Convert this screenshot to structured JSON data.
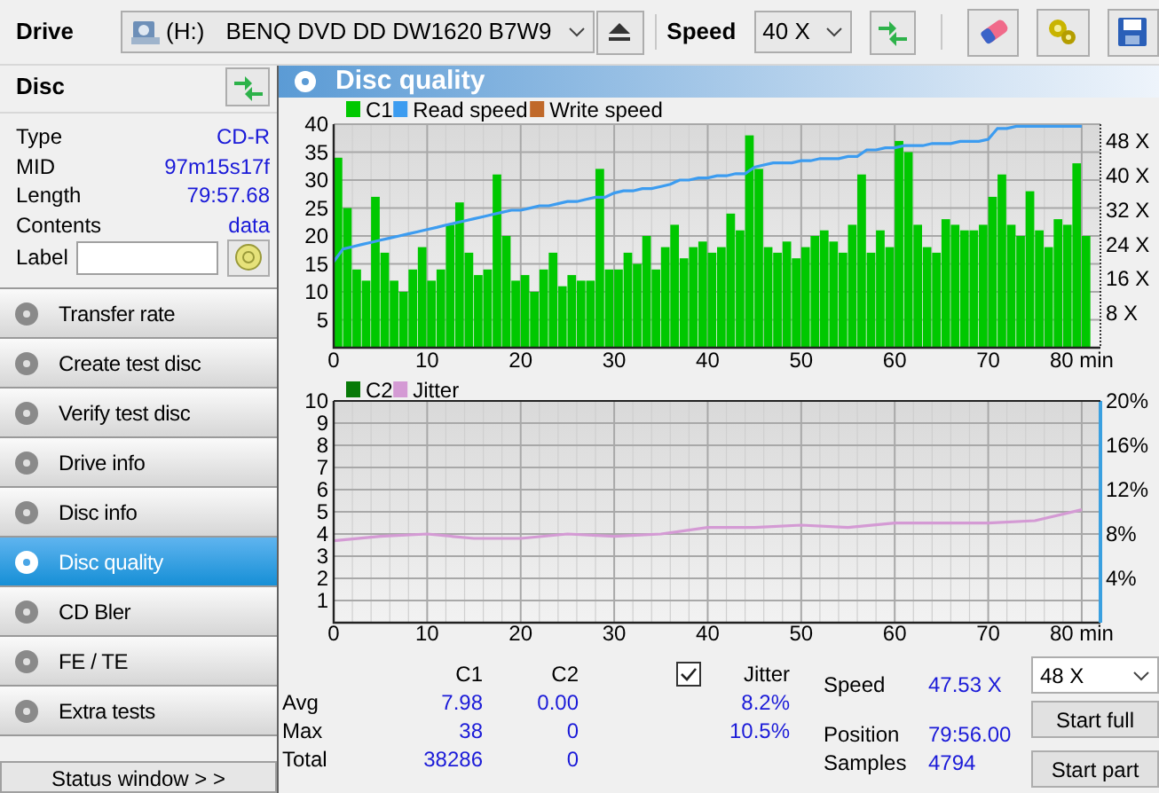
{
  "toolbar": {
    "drive_label": "Drive",
    "drive_letter": "(H:)",
    "drive_name": "BENQ DVD DD DW1620 B7W9",
    "speed_label": "Speed",
    "speed": "40 X"
  },
  "disc": {
    "title": "Disc",
    "info": [
      {
        "label": "Type",
        "value": "CD-R"
      },
      {
        "label": "MID",
        "value": "97m15s17f"
      },
      {
        "label": "Length",
        "value": "79:57.68"
      },
      {
        "label": "Contents",
        "value": "data"
      }
    ],
    "label_field": {
      "label": "Label"
    }
  },
  "nav": [
    {
      "label": "Transfer rate",
      "selected": false
    },
    {
      "label": "Create test disc",
      "selected": false
    },
    {
      "label": "Verify test disc",
      "selected": false
    },
    {
      "label": "Drive info",
      "selected": false
    },
    {
      "label": "Disc info",
      "selected": false
    },
    {
      "label": "Disc quality",
      "selected": true
    },
    {
      "label": "CD Bler",
      "selected": false
    },
    {
      "label": "FE / TE",
      "selected": false
    },
    {
      "label": "Extra tests",
      "selected": false
    }
  ],
  "status_button": "Status window > >",
  "panel": {
    "title": "Disc quality"
  },
  "charts": [
    {
      "chart_data": {
        "type": "bar",
        "grid": true,
        "legend": true,
        "x": [
          0,
          1,
          2,
          3,
          4,
          5,
          6,
          7,
          8,
          9,
          10,
          11,
          12,
          13,
          14,
          15,
          16,
          17,
          18,
          19,
          20,
          21,
          22,
          23,
          24,
          25,
          26,
          27,
          28,
          29,
          30,
          31,
          32,
          33,
          34,
          35,
          36,
          37,
          38,
          39,
          40,
          41,
          42,
          43,
          44,
          45,
          46,
          47,
          48,
          49,
          50,
          51,
          52,
          53,
          54,
          55,
          56,
          57,
          58,
          59,
          60,
          61,
          62,
          63,
          64,
          65,
          66,
          67,
          68,
          69,
          70,
          71,
          72,
          73,
          74,
          75,
          76,
          77,
          78,
          79,
          80
        ],
        "series": [
          {
            "name": "C1",
            "color": "#00c800",
            "values": [
              34,
              25,
              14,
              12,
              27,
              17,
              12,
              10,
              14,
              18,
              12,
              14,
              22,
              26,
              17,
              13,
              14,
              31,
              20,
              12,
              13,
              10,
              14,
              17,
              11,
              13,
              12,
              12,
              32,
              14,
              14,
              17,
              15,
              20,
              14,
              18,
              22,
              16,
              18,
              19,
              17,
              18,
              24,
              21,
              38,
              32,
              18,
              17,
              19,
              16,
              18,
              20,
              21,
              19,
              17,
              22,
              31,
              17,
              21,
              18,
              37,
              35,
              22,
              18,
              17,
              23,
              22,
              21,
              21,
              22,
              27,
              31,
              22,
              20,
              28,
              21,
              18,
              23,
              22,
              33,
              20
            ]
          },
          {
            "name": "Read speed",
            "color": "#3c9cf0",
            "type": "line",
            "axis": "y2",
            "values": [
              20,
              23,
              23.5,
              24,
              24.5,
              25,
              25.5,
              26,
              26.5,
              27,
              27.5,
              28,
              28.5,
              29,
              29.5,
              30,
              30.5,
              31,
              31.5,
              32,
              32,
              32.5,
              33,
              33,
              33.5,
              34,
              34,
              34.5,
              35,
              35,
              36,
              36.5,
              36.5,
              37,
              37,
              37.5,
              38,
              39,
              39,
              39.5,
              39.5,
              40,
              40,
              40.5,
              40.5,
              42,
              42.5,
              43,
              43,
              43,
              43.5,
              43.5,
              44,
              44,
              44,
              44.5,
              44.5,
              46,
              46,
              46.5,
              46.5,
              47,
              47,
              47,
              47.5,
              47.5,
              47.5,
              48,
              48,
              48,
              48.5,
              51,
              51,
              51.5,
              51.5,
              51.5,
              51.5,
              51.5,
              51.5,
              51.5,
              51.5
            ]
          },
          {
            "name": "Write speed",
            "color": "#c0692a",
            "type": "line",
            "axis": "y2",
            "values": [
              null,
              null,
              null,
              null,
              null,
              null,
              null,
              null,
              null,
              null,
              null,
              null,
              null,
              null,
              null,
              null,
              null,
              null,
              null,
              null,
              null,
              null,
              null,
              null,
              null,
              null,
              null,
              null,
              null,
              null,
              null,
              null,
              null,
              null,
              null,
              null,
              null,
              null,
              null,
              null,
              null,
              null,
              null,
              null,
              null,
              null,
              null,
              null,
              null,
              null,
              null,
              null,
              null,
              null,
              null,
              null,
              null,
              null,
              null,
              null,
              null,
              null,
              null,
              null,
              null,
              null,
              null,
              null,
              null,
              null,
              null,
              null,
              null,
              null,
              null,
              null,
              null,
              null,
              null,
              null,
              null
            ]
          }
        ],
        "xlim": [
          0,
          82
        ],
        "ylim": [
          0,
          40
        ],
        "y2lim": [
          0,
          52
        ],
        "xticks": [
          0,
          10,
          20,
          30,
          40,
          50,
          60,
          70,
          {
            "value": 80,
            "label": "80 min"
          }
        ],
        "yticks": [
          5,
          10,
          15,
          20,
          25,
          30,
          35,
          40
        ],
        "y2ticks": [
          {
            "value": 8,
            "label": "8 X"
          },
          {
            "value": 16,
            "label": "16 X"
          },
          {
            "value": 24,
            "label": "24 X"
          },
          {
            "value": 32,
            "label": "32 X"
          },
          {
            "value": 40,
            "label": "40 X"
          },
          {
            "value": 48,
            "label": "48 X"
          }
        ]
      }
    },
    {
      "chart_data": {
        "type": "bar",
        "grid": true,
        "legend": true,
        "x": [
          0,
          5,
          10,
          15,
          20,
          25,
          30,
          35,
          40,
          45,
          50,
          55,
          60,
          65,
          70,
          75,
          80
        ],
        "series": [
          {
            "name": "C2",
            "color": "#087a08",
            "values": [
              0,
              0,
              0,
              0,
              0,
              0,
              0,
              0,
              0,
              0,
              0,
              0,
              0,
              0,
              0,
              0,
              0
            ]
          },
          {
            "name": "Jitter",
            "color": "#d49ad4",
            "type": "line",
            "axis": "y2",
            "values": [
              7.4,
              7.8,
              8,
              7.6,
              7.6,
              8,
              7.8,
              8,
              8.6,
              8.6,
              8.8,
              8.6,
              9,
              9,
              9,
              9.2,
              10.2
            ]
          }
        ],
        "xlim": [
          0,
          82
        ],
        "ylim": [
          0,
          10
        ],
        "y2lim": [
          0,
          20
        ],
        "xticks": [
          0,
          10,
          20,
          30,
          40,
          50,
          60,
          70,
          {
            "value": 80,
            "label": "80 min"
          }
        ],
        "yticks": [
          1,
          2,
          3,
          4,
          5,
          6,
          7,
          8,
          9,
          10
        ],
        "y2ticks": [
          {
            "value": 4,
            "label": "4%"
          },
          {
            "value": 8,
            "label": "8%"
          },
          {
            "value": 12,
            "label": "12%"
          },
          {
            "value": 16,
            "label": "16%"
          },
          {
            "value": 20,
            "label": "20%"
          }
        ]
      }
    }
  ],
  "stats": {
    "columns": [
      "C1",
      "C2"
    ],
    "jitter": {
      "label": "Jitter",
      "checked": true
    },
    "rows": [
      {
        "label": "Avg",
        "c1": "7.98",
        "c2": "0.00",
        "jitter": "8.2%"
      },
      {
        "label": "Max",
        "c1": "38",
        "c2": "0",
        "jitter": "10.5%"
      },
      {
        "label": "Total",
        "c1": "38286",
        "c2": "0"
      }
    ],
    "info": [
      {
        "label": "Speed",
        "value": "47.53 X"
      },
      {
        "label": "Position",
        "value": "79:56.00"
      },
      {
        "label": "Samples",
        "value": "4794"
      }
    ],
    "speed_select": "48 X",
    "buttons": [
      "Start full",
      "Start part"
    ]
  }
}
